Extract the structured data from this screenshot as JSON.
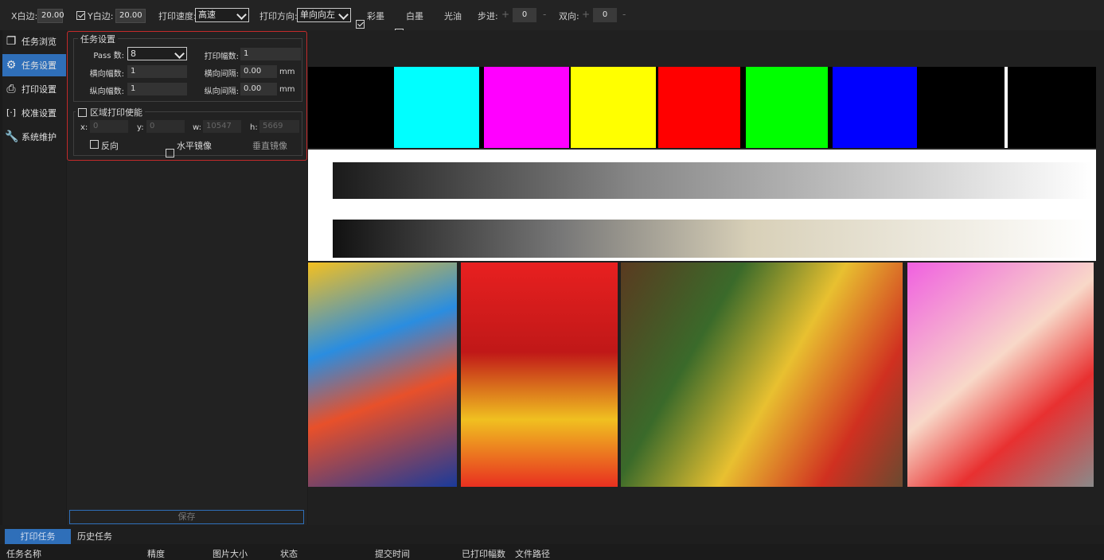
{
  "toolbar": {
    "x_margin_label": "X白边:",
    "x_margin_value": "20.00",
    "y_margin_label": "Y白边:",
    "y_margin_value": "20.00",
    "y_margin_checked": true,
    "speed_label": "打印速度:",
    "speed_value": "高速",
    "direction_label": "打印方向:",
    "direction_value": "单向向左",
    "color_ink_label": "彩墨",
    "color_ink_checked": true,
    "white_ink_label": "白墨",
    "white_ink_checked": true,
    "varnish_label": "光油",
    "varnish_checked": false,
    "step_label": "步进:",
    "step_value": "0",
    "bidir_label": "双向:",
    "bidir_value": "0",
    "plus": "+",
    "minus": "-"
  },
  "sidebar": {
    "items": [
      {
        "label": "任务浏览",
        "icon": "document-copy-icon",
        "active": false
      },
      {
        "label": "任务设置",
        "icon": "gear-icon",
        "active": true
      },
      {
        "label": "打印设置",
        "icon": "printer-icon",
        "active": false
      },
      {
        "label": "校准设置",
        "icon": "calibration-icon",
        "active": false
      },
      {
        "label": "系统维护",
        "icon": "wrench-icon",
        "active": false
      }
    ]
  },
  "task_settings": {
    "group_title": "任务设置",
    "pass_label": "Pass 数:",
    "pass_value": "8",
    "print_copies_label": "打印幅数:",
    "print_copies_value": "1",
    "h_copies_label": "横向幅数:",
    "h_copies_value": "1",
    "h_gap_label": "横向间隔:",
    "h_gap_value": "0.00",
    "h_gap_unit": "mm",
    "v_copies_label": "纵向幅数:",
    "v_copies_value": "1",
    "v_gap_label": "纵向间隔:",
    "v_gap_value": "0.00",
    "v_gap_unit": "mm"
  },
  "region_print": {
    "title": "区域打印使能",
    "enabled": false,
    "x_label": "x:",
    "x_value": "0",
    "y_label": "y:",
    "y_value": "0",
    "w_label": "w:",
    "w_value": "10547",
    "h_label": "h:",
    "h_value": "5669",
    "reverse_label": "反向",
    "hmirror_label": "水平镜像",
    "vmirror_label": "垂直镜像"
  },
  "save_label": "保存",
  "bottom_tabs": [
    {
      "label": "打印任务",
      "active": true
    },
    {
      "label": "历史任务",
      "active": false
    }
  ],
  "columns": [
    "任务名称",
    "精度",
    "图片大小",
    "状态",
    "提交时间",
    "已打印幅数",
    "文件路径"
  ],
  "colors": {
    "accent": "#2f6fb9",
    "highlight_border": "#c42b2b",
    "swatches": [
      "#00ffff",
      "#ff00ff",
      "#ffff00",
      "#ff0000",
      "#00ff00",
      "#0000ff",
      "#000000"
    ]
  }
}
